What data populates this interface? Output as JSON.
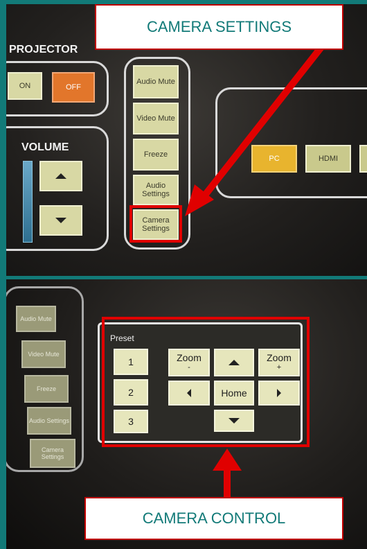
{
  "callouts": {
    "top": "CAMERA SETTINGS",
    "bottom": "CAMERA CONTROL"
  },
  "top_screen": {
    "projector": {
      "title": "PROJECTOR",
      "on": "ON",
      "off": "OFF"
    },
    "volume": {
      "title": "VOLUME"
    },
    "side_menu": {
      "audio_mute": "Audio Mute",
      "video_mute": "Video Mute",
      "freeze": "Freeze",
      "audio_settings": "Audio Settings",
      "camera_settings": "Camera Settings"
    },
    "sources": {
      "pc": "PC",
      "hdmi": "HDMI"
    }
  },
  "bottom_screen": {
    "side_menu": {
      "audio_mute": "Audio Mute",
      "video_mute": "Video Mute",
      "freeze": "Freeze",
      "audio_settings": "Audio Settings",
      "camera_settings": "Camera Settings"
    },
    "camera_control": {
      "preset_label": "Preset",
      "presets": [
        "1",
        "2",
        "3"
      ],
      "zoom_minus": {
        "label": "Zoom",
        "sub": "-"
      },
      "zoom_plus": {
        "label": "Zoom",
        "sub": "+"
      },
      "home": "Home"
    }
  },
  "colors": {
    "border": "#127a78",
    "highlight": "#e00000",
    "callout_text": "#127a78",
    "button": "#d8d8a4",
    "source_active": "#e8b42e",
    "off_button": "#e2762b"
  }
}
